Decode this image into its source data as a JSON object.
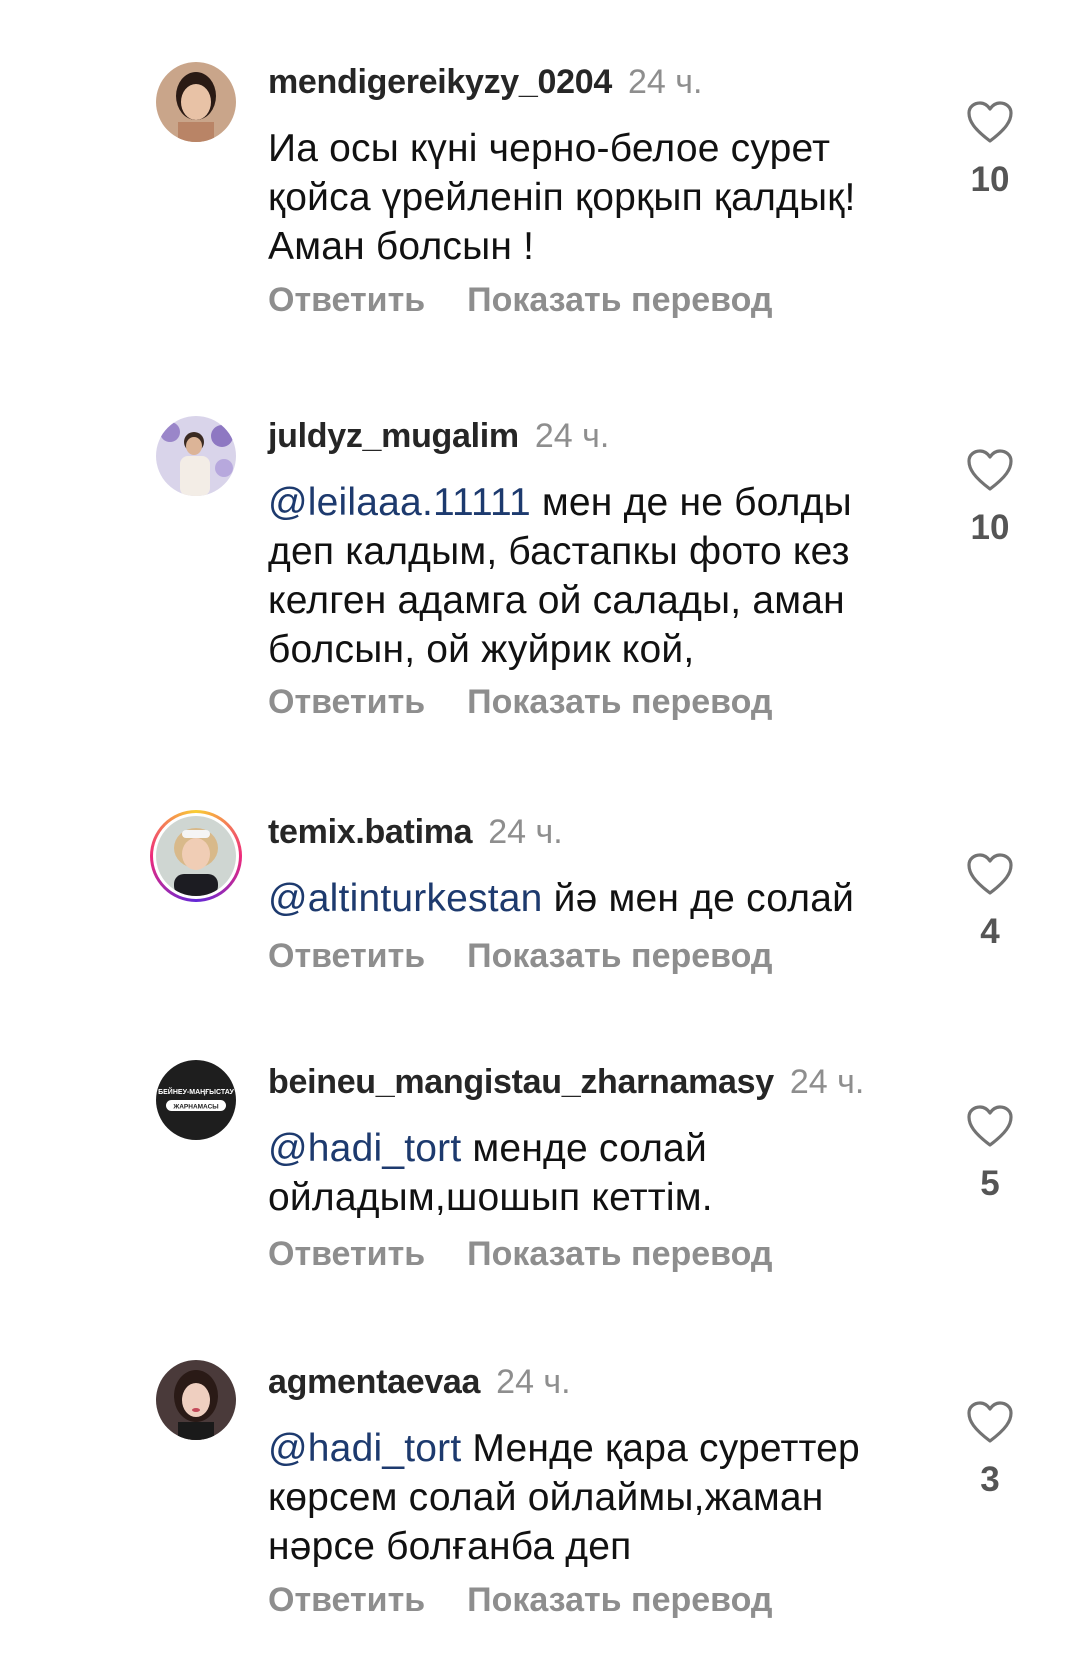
{
  "comments": [
    {
      "username": "mendigereikyzy_0204",
      "time": "24 ч.",
      "mention": "",
      "text": "Иа осы күні черно-белое сурет қойса үрейленіп қорқып қалдық! Аман болсын !",
      "likes": "10",
      "reply_label": "Ответить",
      "translate_label": "Показать перевод"
    },
    {
      "username": "juldyz_mugalim",
      "time": "24 ч.",
      "mention": "@leilaaa.11111",
      "text": " мен де не болды деп калдым, бастапкы фото кез келген адамга ой салады, аман болсын, ой жуйрик кой,",
      "likes": "10",
      "reply_label": "Ответить",
      "translate_label": "Показать перевод"
    },
    {
      "username": "temix.batima",
      "time": "24 ч.",
      "mention": "@altinturkestan",
      "text": " йә мен де солай",
      "likes": "4",
      "reply_label": "Ответить",
      "translate_label": "Показать перевод"
    },
    {
      "username": "beineu_mangistau_zharnamasy",
      "time": "24 ч.",
      "mention": "@hadi_tort",
      "text": " менде солай ойладым,шошып кеттім.",
      "likes": "5",
      "reply_label": "Ответить",
      "translate_label": "Показать перевод",
      "avatar_logo_top": "БЕЙНЕУ-МАҢҒЫСТАУ",
      "avatar_logo_bottom": "ЖАРНАМАСЫ"
    },
    {
      "username": "agmentaevaa",
      "time": "24 ч.",
      "mention": "@hadi_tort",
      "text": " Менде қара суреттер көрсем солай ойлаймы,жаман нәрсе болғанба деп",
      "likes": "3",
      "reply_label": "Ответить",
      "translate_label": "Показать перевод"
    }
  ],
  "icons": {
    "like": "heart-outline-icon"
  },
  "colors": {
    "mention": "#1d3a6e",
    "secondary_text": "#8e8e8e",
    "story_ring": "#ee2a7b"
  }
}
